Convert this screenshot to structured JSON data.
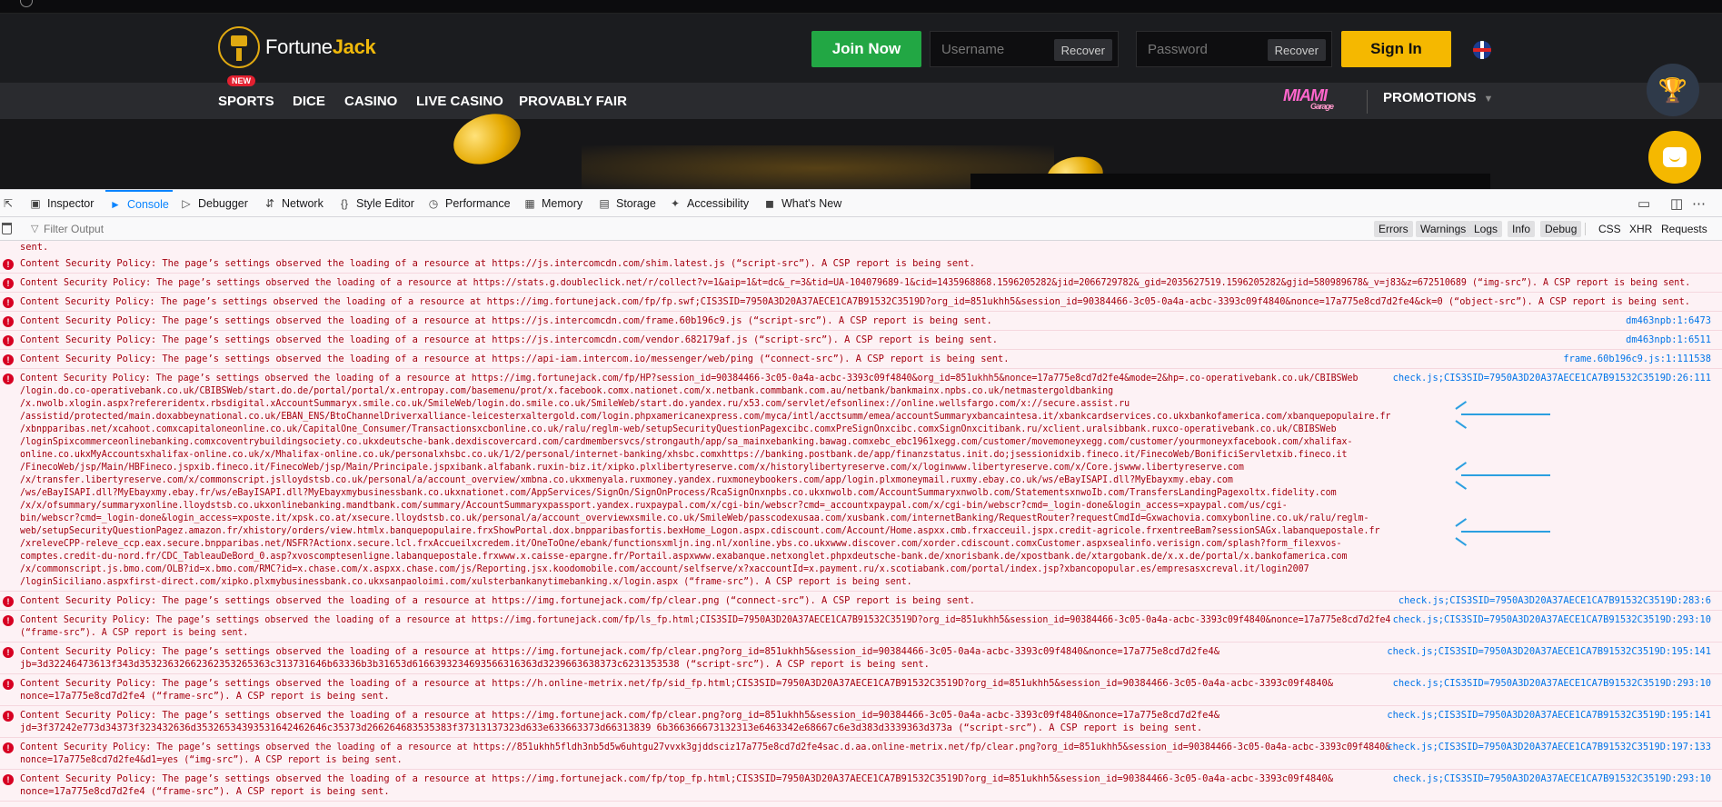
{
  "site": {
    "logo_name": "Fortune",
    "logo_bold": "Jack",
    "join_label": "Join Now",
    "username_placeholder": "Username",
    "password_placeholder": "Password",
    "recover_label": "Recover",
    "signin_label": "Sign In",
    "new_badge": "NEW",
    "nav": [
      "SPORTS",
      "DICE",
      "CASINO",
      "LIVE CASINO",
      "PROVABLY FAIR"
    ],
    "miami_top": "MIAMI",
    "miami_bottom": "Garage",
    "promotions_label": "PROMOTIONS",
    "colors": {
      "join": "#22a744",
      "signin": "#f5b800",
      "brand_gold": "#f0b90b"
    }
  },
  "devtools": {
    "tabs": [
      {
        "label": "Inspector",
        "icon": "inspector-icon"
      },
      {
        "label": "Console",
        "icon": "console-icon",
        "active": true
      },
      {
        "label": "Debugger",
        "icon": "debugger-icon"
      },
      {
        "label": "Network",
        "icon": "network-icon"
      },
      {
        "label": "Style Editor",
        "icon": "style-editor-icon"
      },
      {
        "label": "Performance",
        "icon": "performance-icon"
      },
      {
        "label": "Memory",
        "icon": "memory-icon"
      },
      {
        "label": "Storage",
        "icon": "storage-icon"
      },
      {
        "label": "Accessibility",
        "icon": "accessibility-icon"
      },
      {
        "label": "What's New",
        "icon": "whats-new-icon"
      }
    ],
    "filter_placeholder": "Filter Output",
    "levels": [
      "Errors",
      "Warnings",
      "Logs",
      "Info",
      "Debug"
    ],
    "extra_filters": [
      "CSS",
      "XHR",
      "Requests"
    ],
    "top_partial": "sent.",
    "messages": [
      {
        "lines": [
          "Content Security Policy: The page’s settings observed the loading of a resource at https://js.intercomcdn.com/shim.latest.js (“script-src”). A CSP report is being sent."
        ],
        "loc": ""
      },
      {
        "lines": [
          "Content Security Policy: The page’s settings observed the loading of a resource at https://stats.g.doubleclick.net/r/collect?v=1&aip=1&t=dc&_r=3&tid=UA-104079689-1&cid=1435968868.1596205282&jid=2066729782&_gid=2035627519.1596205282&gjid=580989678&_v=j83&z=672510689 (“img-src”). A CSP report is being sent."
        ],
        "loc": ""
      },
      {
        "lines": [
          "Content Security Policy: The page’s settings observed the loading of a resource at https://img.fortunejack.com/fp/fp.swf;CIS3SID=7950A3D20A37AECE1CA7B91532C3519D?org_id=851ukhh5&session_id=90384466-3c05-0a4a-acbc-3393c09f4840&nonce=17a775e8cd7d2fe4&ck=0 (“object-src”). A CSP report is being sent."
        ],
        "loc": ""
      },
      {
        "lines": [
          "Content Security Policy: The page’s settings observed the loading of a resource at https://js.intercomcdn.com/frame.60b196c9.js (“script-src”). A CSP report is being sent."
        ],
        "loc": "dm463npb:1:6473"
      },
      {
        "lines": [
          "Content Security Policy: The page’s settings observed the loading of a resource at https://js.intercomcdn.com/vendor.682179af.js (“script-src”). A CSP report is being sent."
        ],
        "loc": "dm463npb:1:6511"
      },
      {
        "lines": [
          "Content Security Policy: The page’s settings observed the loading of a resource at https://api-iam.intercom.io/messenger/web/ping (“connect-src”). A CSP report is being sent."
        ],
        "loc": "frame.60b196c9.js:1:111538"
      },
      {
        "lines": [
          "Content Security Policy: The page’s settings observed the loading of a resource at https://img.fortunejack.com/fp/HP?session_id=90384466-3c05-0a4a-acbc-3393c09f4840&org_id=851ukhh5&nonce=17a775e8cd7d2fe4&mode=2&hp=.co-operativebank.co.uk/CBIBSWeb",
          "/login.do.co-operativebank.co.uk/CBIBSWeb/start.do.de/portal/portal/x.entropay.com/basemenu/prot/x.facebook.comx.nationet.com/x.netbank.commbank.com.au/netbank/bankmainx.npbs.co.uk/netmastergoldbanking",
          "/x.nwolb.xlogin.aspx?refereridentx.rbsdigital.xAccountSummaryx.smile.co.uk/SmileWeb/login.do.smile.co.uk/SmileWeb/start.do.yandex.ru/x53.com/servlet/efsonlinex://online.wellsfargo.com/x://secure.assist.ru",
          "/assistid/protected/main.doxabbeynational.co.uk/EBAN_ENS/BtoChannelDriverxalliance-leicesterxaltergold.com/login.phpxamericanexpress.com/myca/intl/acctsumm/emea/accountSummaryxbancaintesa.it/xbankcardservices.co.ukxbankofamerica.com/xbanquepopulaire.fr",
          "/xbnpparibas.net/xcahoot.comxcapitaloneonline.co.uk/CapitalOne_Consumer/Transactionsxcbonline.co.uk/ralu/reglm-web/setupSecurityQuestionPagexcibc.comxPreSignOnxcibc.comxSignOnxcitibank.ru/xclient.uralsibbank.ruxco-operativebank.co.uk/CBIBSWeb",
          "/loginSpixcommerceonlinebanking.comxcoventrybuildingsociety.co.ukxdeutsche-bank.dexdiscovercard.com/cardmembersvcs/strongauth/app/sa_mainxebanking.bawag.comxebc_ebc1961xegg.com/customer/movemoneyxegg.com/customer/yourmoneyxfacebook.com/xhalifax-",
          "online.co.ukxMyAccountsxhalifax-online.co.uk/x/Mhalifax-online.co.uk/personalxhsbc.co.uk/1/2/personal/internet-banking/xhsbc.comxhttps://banking.postbank.de/app/finanzstatus.init.do;jsessionidxib.fineco.it/FinecoWeb/BonificiServletxib.fineco.it",
          "/FinecoWeb/jsp/Main/HBFineco.jspxib.fineco.it/FinecoWeb/jsp/Main/Principale.jspxibank.alfabank.ruxin-biz.it/xipko.plxlibertyreserve.com/x/historylibertyreserve.com/x/loginwww.libertyreserve.com/x/Core.jswww.libertyreserve.com",
          "/x/transfer.libertyreserve.com/x/commonscript.jslloydstsb.co.uk/personal/a/account_overview/xmbna.co.ukxmenyala.ruxmoney.yandex.ruxmoneybookers.com/app/login.plxmoneymail.ruxmy.ebay.co.uk/ws/eBayISAPI.dll?MyEbayxmy.ebay.com",
          "/ws/eBayISAPI.dll?MyEbayxmy.ebay.fr/ws/eBayISAPI.dll?MyEbayxmybusinessbank.co.ukxnationet.com/AppServices/SignOn/SignOnProcess/RcaSignOnxnpbs.co.ukxnwolb.com/AccountSummaryxnwolb.com/StatementsxnwoIb.com/TransfersLandingPagexoltx.fidelity.com",
          "/x/x/ofsummary/summaryxonline.lloydstsb.co.ukxonlinebanking.mandtbank.com/summary/AccountSummaryxpassport.yandex.ruxpaypal.com/x/cgi-bin/webscr?cmd=_accountxpaypal.com/x/cgi-bin/webscr?cmd=_login-done&login_access=xpaypal.com/us/cgi-",
          "bin/webscr?cmd=_login-done&login_access=xposte.it/xpsk.co.at/xsecure.lloydstsb.co.uk/personal/a/account_overviewxsmile.co.uk/SmileWeb/passcodexusaa.com/xusbank.com/internetBanking/RequestRouter?requestCmdId=Gxwachovia.comxybonline.co.uk/ralu/reglm-",
          "web/setupSecurityQuestionPagez.amazon.fr/xhistory/orders/view.htmlx.banquepopulaire.frxShowPortal.dox.bnpparibasfortis.bexHome_Logon.aspx.cdiscount.com/Account/Home.aspxx.cmb.frxacceuil.jspx.credit-agricole.frxentreeBam?sessionSAGx.labanquepostale.fr",
          "/xreleveCPP-releve_ccp.eax.secure.bnpparibas.net/NSFR?Actionx.secure.lcl.frxAccueilxcredem.it/OneToOne/ebank/functionsxmljn.ing.nl/xonline.ybs.co.ukxwww.discover.com/xorder.cdiscount.comxCustomer.aspxsealinfo.verisign.com/splash?form_filexvos-",
          "comptes.credit-du-nord.fr/CDC_TableauDeBord_0.asp?xvoscomptesenligne.labanquepostale.frxwww.x.caisse-epargne.fr/Portail.aspxwww.exabanque.netxonglet.phpxdeutsche-bank.de/xnorisbank.de/xpostbank.de/xtargobank.de/x.x.de/portal/x.bankofamerica.com",
          "/x/commonscript.js.bmo.com/OLB?id=x.bmo.com/RMC?id=x.chase.com/x.aspxx.chase.com/js/Reporting.jsx.koodomobile.com/account/selfserve/x?xaccountId=x.payment.ru/x.scotiabank.com/portal/index.jsp?xbancopopular.es/empresasxcreval.it/login2007",
          "/loginSiciliano.aspxfirst-direct.com/xipko.plxmybusinessbank.co.ukxsanpaoloimi.com/xulsterbankanytimebanking.x/login.aspx (“frame-src”). A CSP report is being sent."
        ],
        "loc": "check.js;CIS3SID=7950A3D20A37AECE1CA7B91532C3519D:26:111"
      },
      {
        "lines": [
          "Content Security Policy: The page’s settings observed the loading of a resource at https://img.fortunejack.com/fp/clear.png (“connect-src”). A CSP report is being sent."
        ],
        "loc": "check.js;CIS3SID=7950A3D20A37AECE1CA7B91532C3519D:283:6"
      },
      {
        "lines": [
          "Content Security Policy: The page’s settings observed the loading of a resource at https://img.fortunejack.com/fp/ls_fp.html;CIS3SID=7950A3D20A37AECE1CA7B91532C3519D?org_id=851ukhh5&session_id=90384466-3c05-0a4a-acbc-3393c09f4840&nonce=17a775e8cd7d2fe4",
          "(“frame-src”). A CSP report is being sent."
        ],
        "loc": "check.js;CIS3SID=7950A3D20A37AECE1CA7B91532C3519D:293:10"
      },
      {
        "lines": [
          "Content Security Policy: The page’s settings observed the loading of a resource at https://img.fortunejack.com/fp/clear.png?org_id=851ukhh5&session_id=90384466-3c05-0a4a-acbc-3393c09f4840&nonce=17a775e8cd7d2fe4&",
          "jb=3d32246473613f343d35323632662362353265363c313731646b63336b3b31653d6166393234693566316363d3239663638373c6231353538 (“script-src”). A CSP report is being sent."
        ],
        "loc": "check.js;CIS3SID=7950A3D20A37AECE1CA7B91532C3519D:195:141"
      },
      {
        "lines": [
          "Content Security Policy: The page’s settings observed the loading of a resource at https://h.online-metrix.net/fp/sid_fp.html;CIS3SID=7950A3D20A37AECE1CA7B91532C3519D?org_id=851ukhh5&session_id=90384466-3c05-0a4a-acbc-3393c09f4840&",
          "nonce=17a775e8cd7d2fe4 (“frame-src”). A CSP report is being sent."
        ],
        "loc": "check.js;CIS3SID=7950A3D20A37AECE1CA7B91532C3519D:293:10"
      },
      {
        "lines": [
          "Content Security Policy: The page’s settings observed the loading of a resource at https://img.fortunejack.com/fp/clear.png?org_id=851ukhh5&session_id=90384466-3c05-0a4a-acbc-3393c09f4840&nonce=17a775e8cd7d2fe4&",
          "jd=3f37242e773d34373f323432636d35326534393531642462646c35373d266264683535383f37313137323d633e633663373d66313839 6b366366673132313e6463342e68667c6e3d383d3339363d373a (“script-src”). A CSP report is being sent."
        ],
        "loc": "check.js;CIS3SID=7950A3D20A37AECE1CA7B91532C3519D:195:141"
      },
      {
        "lines": [
          "Content Security Policy: The page’s settings observed the loading of a resource at https://851ukhh5fldh3nb5d5w6uhtgu27vvxk3gjddsciz17a775e8cd7d2fe4sac.d.aa.online-metrix.net/fp/clear.png?org_id=851ukhh5&session_id=90384466-3c05-0a4a-acbc-3393c09f4840&",
          "nonce=17a775e8cd7d2fe4&d1=yes (“img-src”). A CSP report is being sent."
        ],
        "loc": "check.js;CIS3SID=7950A3D20A37AECE1CA7B91532C3519D:197:133"
      },
      {
        "lines": [
          "Content Security Policy: The page’s settings observed the loading of a resource at https://img.fortunejack.com/fp/top_fp.html;CIS3SID=7950A3D20A37AECE1CA7B91532C3519D?org_id=851ukhh5&session_id=90384466-3c05-0a4a-acbc-3393c09f4840&",
          "nonce=17a775e8cd7d2fe4 (“frame-src”). A CSP report is being sent."
        ],
        "loc": "check.js;CIS3SID=7950A3D20A37AECE1CA7B91532C3519D:293:10"
      }
    ]
  }
}
